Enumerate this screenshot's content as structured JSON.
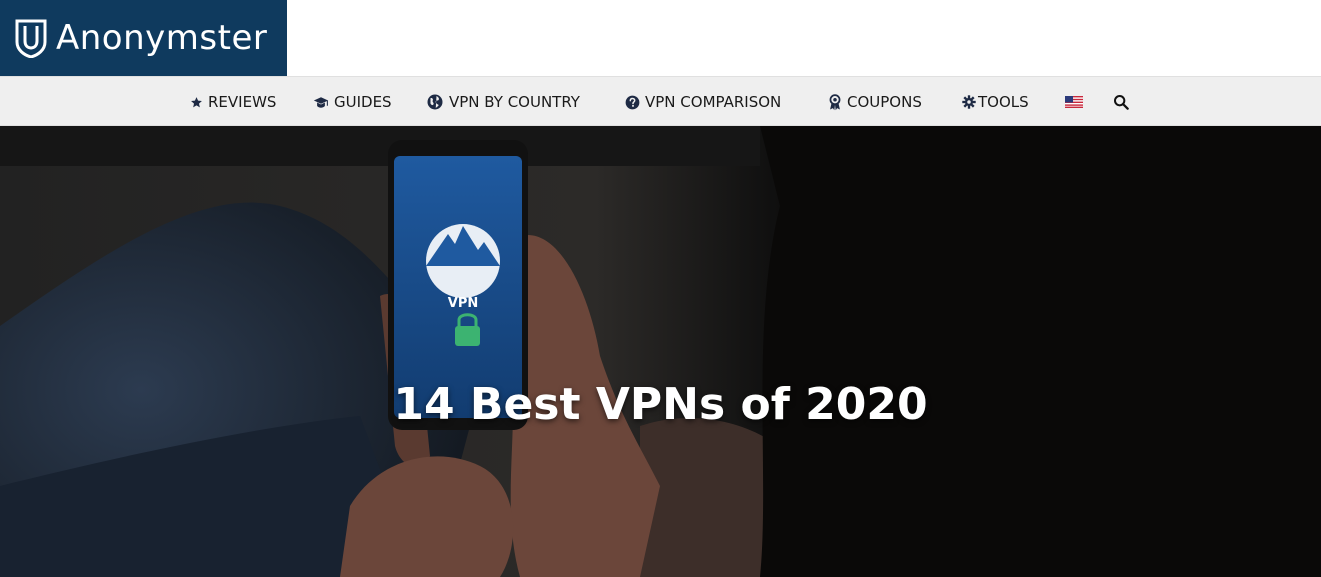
{
  "brand": {
    "name": "Anonymster",
    "bg_color": "#0f3a5e"
  },
  "nav": {
    "items": [
      {
        "label": "REVIEWS",
        "icon": "star-icon"
      },
      {
        "label": "GUIDES",
        "icon": "graduation-cap-icon"
      },
      {
        "label": "VPN BY COUNTRY",
        "icon": "globe-icon"
      },
      {
        "label": "VPN COMPARISON",
        "icon": "question-circle-icon"
      },
      {
        "label": "COUPONS",
        "icon": "award-icon"
      },
      {
        "label": "TOOLS",
        "icon": "gear-icon"
      }
    ],
    "flag_icon": "us-flag-icon",
    "search_icon": "search-icon"
  },
  "hero": {
    "title": "14 Best VPNs of 2020",
    "phone_screen_text": "VPN"
  }
}
